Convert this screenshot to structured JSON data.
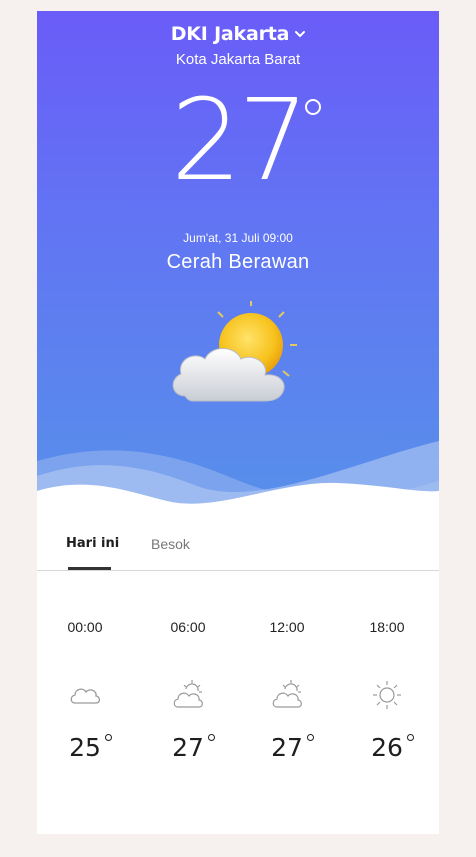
{
  "header": {
    "city": "DKI Jakarta",
    "subregion": "Kota Jakarta Barat"
  },
  "current": {
    "temperature": "27",
    "datetime": "Jum'at, 31 Juli 09:00",
    "condition": "Cerah Berawan",
    "icon": "sun-behind-cloud-icon"
  },
  "tabs": [
    {
      "label": "Hari ini",
      "active": true
    },
    {
      "label": "Besok",
      "active": false
    }
  ],
  "hourly": [
    {
      "time": "00:00",
      "temp": "25",
      "icon": "cloud-icon"
    },
    {
      "time": "06:00",
      "temp": "27",
      "icon": "partly-cloudy-icon"
    },
    {
      "time": "12:00",
      "temp": "27",
      "icon": "partly-cloudy-icon"
    },
    {
      "time": "18:00",
      "temp": "26",
      "icon": "sun-icon"
    }
  ],
  "colors": {
    "gradient_top": "#6a5cf8",
    "gradient_bottom": "#5790ea",
    "background": "#f6f1ee",
    "text_dark": "#1e1e1e"
  }
}
